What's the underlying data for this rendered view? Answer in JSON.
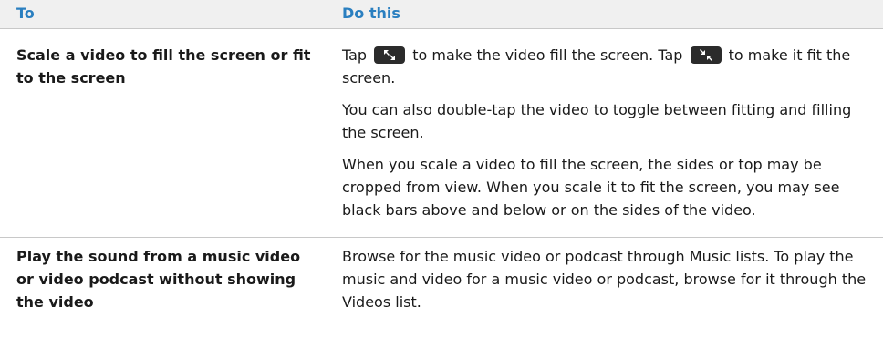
{
  "header": {
    "col1": "To",
    "col2": "Do this"
  },
  "rows": [
    {
      "to": "Scale a video to fill the screen or fit to the screen",
      "tap1": "Tap",
      "after1": "to make the video fill the screen. Tap",
      "after2": "to make it fit the screen.",
      "p2": "You can also double-tap the video to toggle between fitting and filling the screen.",
      "p3": "When you scale a video to fill the screen, the sides or top may be cropped from view. When you scale it to fit the screen, you may see black bars above and below or on the sides of the video."
    },
    {
      "to": "Play the sound from a music video or video podcast without showing the video",
      "p1": "Browse for the music video or podcast through Music lists. To play the music and video for a music video or podcast, browse for it through the Videos list."
    }
  ],
  "icons": {
    "fill": "expand-arrows-icon",
    "fit": "contract-arrows-icon"
  },
  "colors": {
    "header_text": "#2a7fc0",
    "header_bg": "#f0f0f0",
    "icon_bg": "#2b2b2b"
  }
}
